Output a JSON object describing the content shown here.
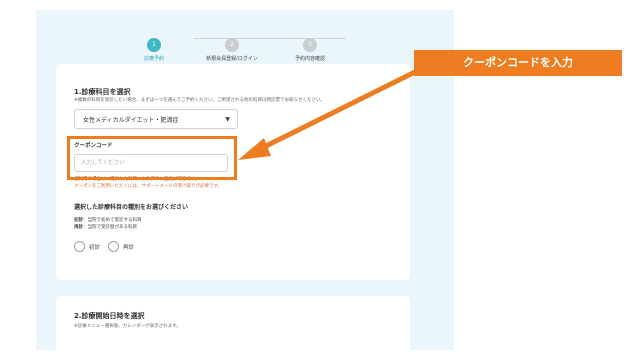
{
  "stepper": {
    "steps": [
      {
        "number": "1",
        "label": "診療予約"
      },
      {
        "number": "2",
        "label": "新規会員登録/ログイン"
      },
      {
        "number": "3",
        "label": "予約内容確認"
      }
    ]
  },
  "section1": {
    "title": "1.診療科目を選択",
    "note": "※複数の科目を受診したい場合、まずは一つを選んでご予約ください。ご希望される他の科目は問診票でお知らせください。",
    "select_value": "女性メディカルダイエット・肥満症"
  },
  "coupon": {
    "label": "クーポンコード",
    "placeholder": "入力してください",
    "note1": "ご利用の場合は、選択した科目によりプラン変更が可能です。",
    "note2": "クーポンをご利用いただくには、サポートメールの受け取りが必要です。"
  },
  "type": {
    "title": "選択した診療科目の種別をお選びください",
    "line1_bold": "初診",
    "line1_text": "：当院で初めて受診する科目",
    "line2_bold": "再診",
    "line2_text": "：当院で受診歴がある科目",
    "options": [
      "初診",
      "再診"
    ]
  },
  "section2": {
    "title": "2.診療開始日時を選択",
    "note": "※診療メニュー選択後、カレンダーが表示されます。"
  },
  "annotation": {
    "callout": "クーポンコードを入力"
  },
  "colors": {
    "accent": "#3fb7c5",
    "annotation": "#ee7d22",
    "background": "#eaf6fb"
  }
}
